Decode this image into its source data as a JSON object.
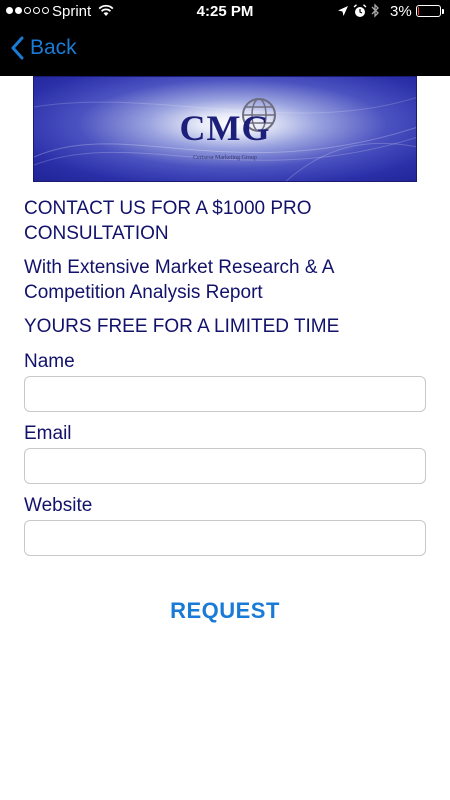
{
  "status_bar": {
    "carrier": "Sprint",
    "time": "4:25 PM",
    "battery_percent": "3%",
    "battery_level": 0.03,
    "signal_bars": 2,
    "signal_total": 5,
    "icons": [
      "wifi-icon",
      "location-icon",
      "alarm-icon",
      "bluetooth-icon",
      "battery-icon"
    ]
  },
  "nav": {
    "back_label": "Back"
  },
  "banner": {
    "logo_text": "CMG",
    "logo_subtitle": "Cerisesa Marketing Group"
  },
  "content": {
    "headline": "CONTACT US FOR A $1000 PRO CONSULTATION",
    "subhead": "With Extensive Market Research & A Competition Analysis Report",
    "offer": "YOURS FREE FOR A LIMITED TIME"
  },
  "form": {
    "name_label": "Name",
    "name_value": "",
    "email_label": "Email",
    "email_value": "",
    "website_label": "Website",
    "website_value": "",
    "submit_label": "REQUEST"
  },
  "colors": {
    "nav_background": "#000000",
    "accent_blue": "#1a7bd6",
    "text_navy": "#12126b",
    "banner_blue": "#2a2fa8"
  }
}
